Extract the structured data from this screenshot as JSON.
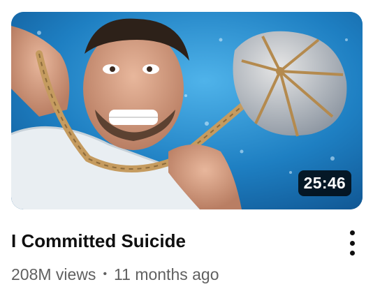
{
  "video": {
    "duration": "25:46",
    "title": "I Committed Suicide",
    "views": "208M views",
    "separator": "•",
    "age": "11 months ago"
  },
  "icons": {
    "menu": "more-vert-icon"
  },
  "colors": {
    "title": "#0f0f0f",
    "subtext": "#606060",
    "badge_bg": "#000000"
  }
}
